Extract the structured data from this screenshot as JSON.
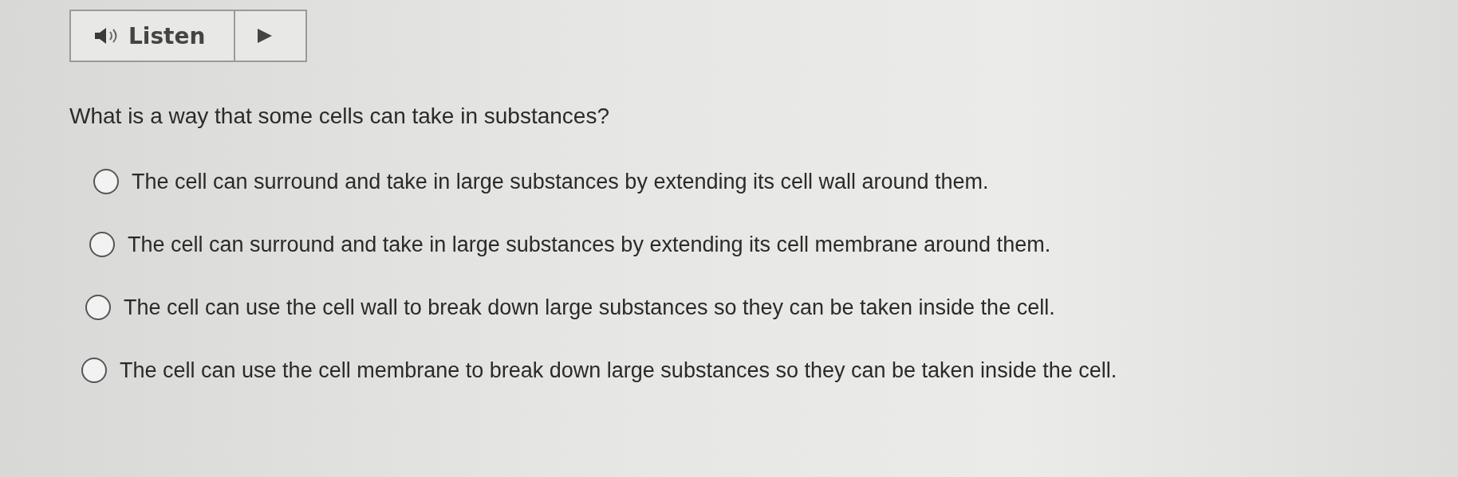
{
  "audio_player": {
    "label": "Listen"
  },
  "question": "What is a way that some cells can take in substances?",
  "options": [
    {
      "text": "The cell can surround and take in large substances by extending its cell wall around them.",
      "selected": false
    },
    {
      "text": "The cell can surround and take in large substances by extending its cell membrane around them.",
      "selected": false
    },
    {
      "text": "The cell can use the cell wall to break down large substances so they can be taken inside the cell.",
      "selected": false
    },
    {
      "text": "The cell can use the cell membrane to break down large substances so they can be taken inside the cell.",
      "selected": false
    }
  ]
}
